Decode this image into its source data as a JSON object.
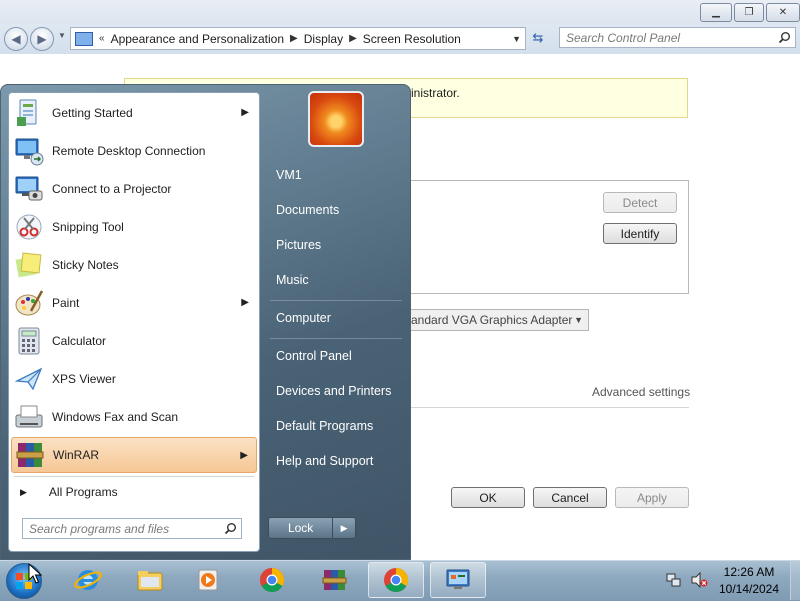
{
  "window": {
    "minimize_glyph": "▁",
    "maximize_glyph": "❐",
    "close_glyph": "✕"
  },
  "address": {
    "prefix": "«",
    "crumbs": [
      "Appearance and Personalization",
      "Display",
      "Screen Resolution"
    ]
  },
  "search": {
    "placeholder": "Search Control Panel"
  },
  "content": {
    "notice_text": "inistrator.",
    "detect_label": "Detect",
    "identify_label": "Identify",
    "adapter_value": "andard VGA Graphics Adapter",
    "advanced_link": "Advanced settings",
    "ok_label": "OK",
    "cancel_label": "Cancel",
    "apply_label": "Apply"
  },
  "start_menu": {
    "programs": [
      {
        "label": "Getting Started",
        "icon": "getting-started-icon",
        "has_arrow": true
      },
      {
        "label": "Remote Desktop Connection",
        "icon": "remote-desktop-icon",
        "has_arrow": false
      },
      {
        "label": "Connect to a Projector",
        "icon": "projector-icon",
        "has_arrow": false
      },
      {
        "label": "Snipping Tool",
        "icon": "snipping-tool-icon",
        "has_arrow": false
      },
      {
        "label": "Sticky Notes",
        "icon": "sticky-notes-icon",
        "has_arrow": false
      },
      {
        "label": "Paint",
        "icon": "paint-icon",
        "has_arrow": true
      },
      {
        "label": "Calculator",
        "icon": "calculator-icon",
        "has_arrow": false
      },
      {
        "label": "XPS Viewer",
        "icon": "xps-viewer-icon",
        "has_arrow": false
      },
      {
        "label": "Windows Fax and Scan",
        "icon": "fax-scan-icon",
        "has_arrow": false
      },
      {
        "label": "WinRAR",
        "icon": "winrar-icon",
        "has_arrow": true,
        "highlighted": true
      }
    ],
    "all_programs": "All Programs",
    "search_placeholder": "Search programs and files",
    "right_items": [
      "VM1",
      "Documents",
      "Pictures",
      "Music",
      "Computer",
      "Control Panel",
      "Devices and Printers",
      "Default Programs",
      "Help and Support"
    ],
    "lock_label": "Lock"
  },
  "taskbar": {
    "pinned": [
      "internet-explorer-icon",
      "file-explorer-icon",
      "media-player-icon",
      "chrome-icon",
      "winrar-icon",
      "chrome-icon",
      "control-panel-icon"
    ],
    "time": "12:26 AM",
    "date": "10/14/2024"
  }
}
